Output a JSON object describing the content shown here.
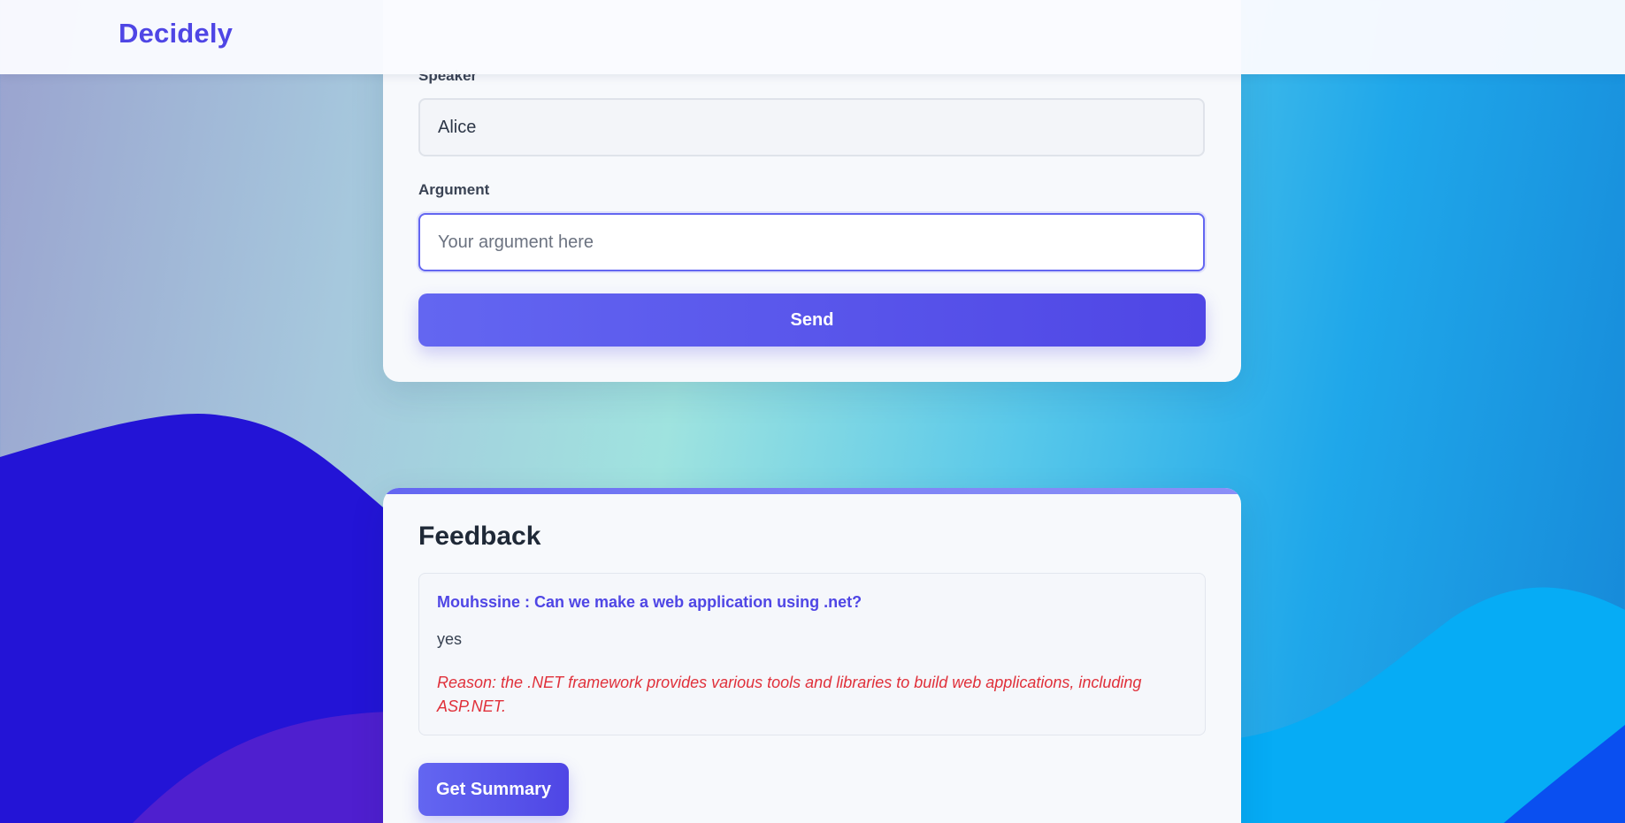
{
  "app": {
    "brand": "Decidely"
  },
  "form": {
    "speaker_label": "Speaker",
    "speaker_value": "Alice",
    "argument_label": "Argument",
    "argument_placeholder": "Your argument here",
    "argument_value": "",
    "send_label": "Send"
  },
  "feedback": {
    "title": "Feedback",
    "items": [
      {
        "question": "Mouhssine : Can we make a web application using .net?",
        "answer": "yes",
        "reason": "Reason: the .NET framework provides various tools and libraries to build web applications, including ASP.NET."
      }
    ],
    "summary_label": "Get Summary"
  },
  "colors": {
    "accent": "#4f46e5",
    "accent_light": "#6366f1",
    "reason_text": "#e0303a",
    "heading": "#1f2937"
  }
}
